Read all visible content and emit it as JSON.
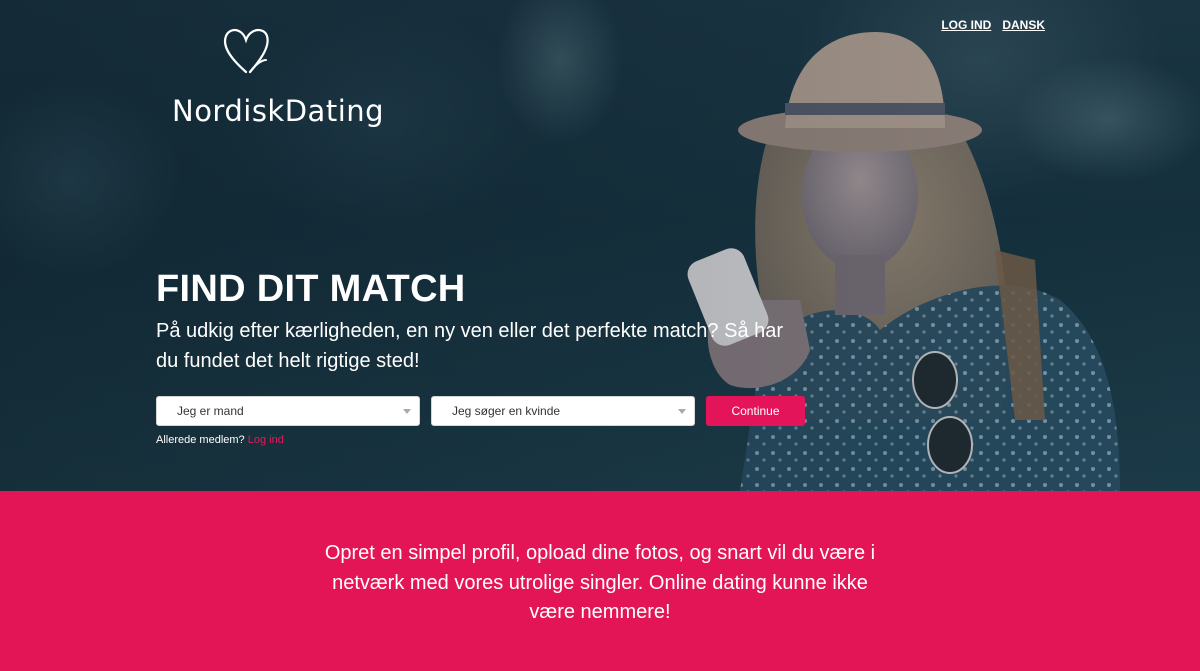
{
  "brand": {
    "name": "NordiskDating"
  },
  "nav": {
    "login": "LOG IND",
    "language": "DANSK"
  },
  "hero": {
    "headline": "FIND DIT MATCH",
    "subline": "På udkig efter kærligheden, en ny ven eller det perfekte match? Så har du fundet det helt rigtige sted!",
    "gender_select": "Jeg er mand",
    "seeking_select": "Jeg søger en kvinde",
    "continue": "Continue",
    "member_prefix": "Allerede medlem?",
    "member_login": "Log ind"
  },
  "band": {
    "text": "Opret en simpel profil, opload dine fotos, og snart vil du være i netværk med vores utrolige singler. Online dating kunne ikke være nemmere!"
  },
  "colors": {
    "accent": "#e41556",
    "hero_bg": "#15303d"
  }
}
